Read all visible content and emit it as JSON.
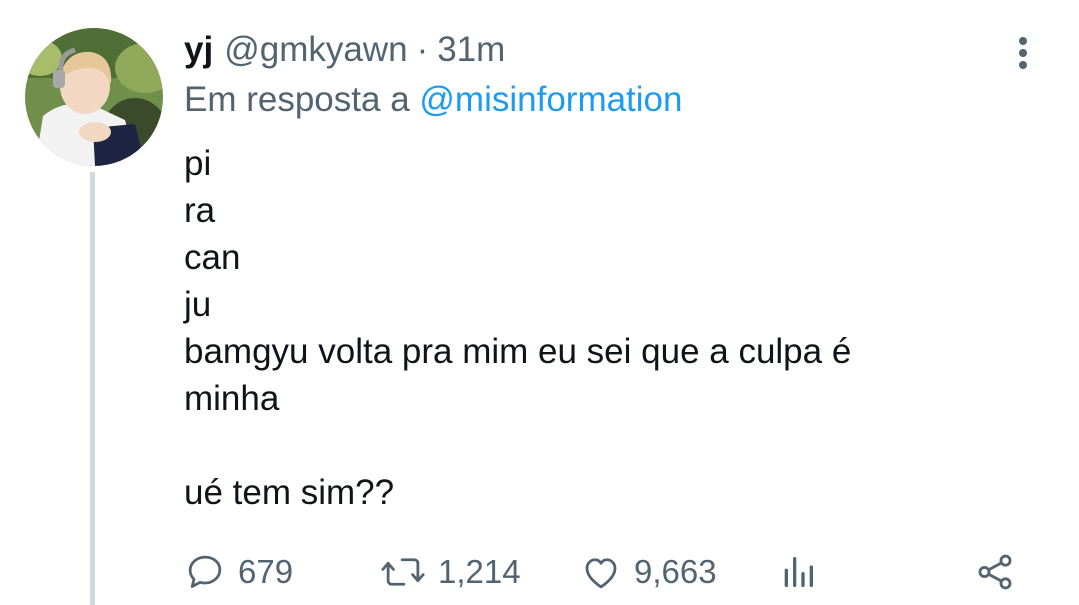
{
  "tweet": {
    "display_name": "yj",
    "handle": "@gmkyawn",
    "separator": "·",
    "time": "31m",
    "reply_prefix": "Em resposta a",
    "reply_mention": "@misinformation",
    "body_lines": [
      "pi",
      "ra",
      "can",
      "ju",
      "bamgyu volta pra mim eu sei que a culpa é",
      "minha",
      "",
      "ué tem sim??"
    ]
  },
  "actions": {
    "replies": "679",
    "retweets": "1,214",
    "likes": "9,663",
    "icons": [
      "reply-icon",
      "retweet-icon",
      "like-icon",
      "analytics-icon",
      "share-icon"
    ]
  },
  "colors": {
    "text": "#0f1419",
    "secondary": "#536471",
    "accent": "#1d9bf0",
    "thread_line": "#cfd9de"
  }
}
